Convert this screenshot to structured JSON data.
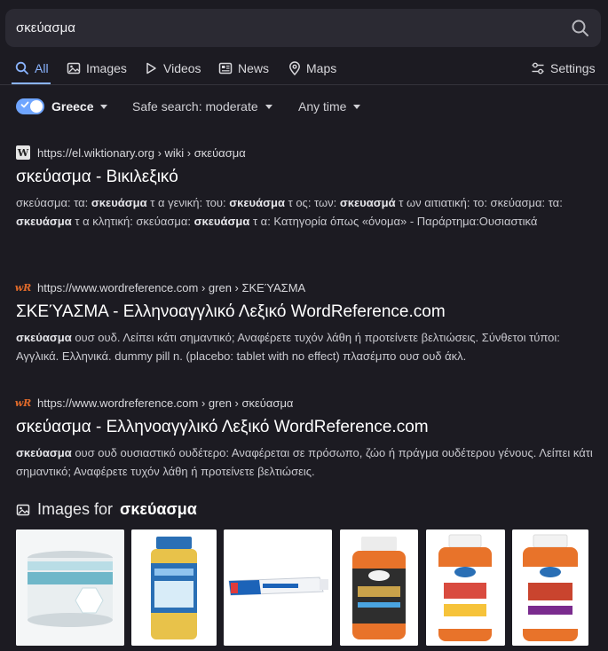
{
  "search": {
    "query": "σκεύασμα"
  },
  "tabs": [
    {
      "label": "All",
      "icon": "search-icon"
    },
    {
      "label": "Images",
      "icon": "image-icon"
    },
    {
      "label": "Videos",
      "icon": "play-icon"
    },
    {
      "label": "News",
      "icon": "news-icon"
    },
    {
      "label": "Maps",
      "icon": "map-pin-icon"
    }
  ],
  "settings_label": "Settings",
  "filters": {
    "region": "Greece",
    "safe_search": "Safe search: moderate",
    "time": "Any time"
  },
  "results": [
    {
      "url": "https://el.wiktionary.org › wiki › σκεύασμα",
      "title": "σκεύασμα - Βικιλεξικό",
      "favicon": "W",
      "snippet_html": "σκεύασμα: τα: <b>σκευάσμα</b> τ α γενική: του: <b>σκευάσμα</b> τ ος: των: <b>σκευασμά</b> τ ων αιτιατική: το: σκεύασμα: τα: <b>σκευάσμα</b> τ α κλητική: σκεύασμα: <b>σκευάσμα</b> τ α: Κατηγορία όπως «όνομα» - Παράρτημα:Ουσιαστικά"
    },
    {
      "url": "https://www.wordreference.com › gren › ΣΚΕΎΑΣΜΑ",
      "title": "ΣΚΕΎΑΣΜΑ - Ελληνοαγγλικό Λεξικό WordReference.com",
      "favicon": "wR",
      "snippet_html": "<b>σκεύασμα</b> ουσ ουδ. Λείπει κάτι σημαντικό; Αναφέρετε τυχόν λάθη ή προτείνετε βελτιώσεις. Σύνθετοι τύποι: Αγγλικά. Ελληνικά. dummy pill n. (placebo: tablet with no effect) πλασέμπο ουσ ουδ άκλ."
    },
    {
      "url": "https://www.wordreference.com › gren › σκεύασμα",
      "title": "σκεύασμα - Ελληνοαγγλικό Λεξικό WordReference.com",
      "favicon": "wR",
      "snippet_html": "<b>σκεύασμα</b> ουσ ουδ ουσιαστικό ουδέτερο: Αναφέρεται σε πρόσωπο, ζώο ή πράγμα ουδέτερου γένους. Λείπει κάτι σημαντικό; Αναφέρετε τυχόν λάθη ή προτείνετε βελτιώσεις."
    }
  ],
  "images_section": {
    "prefix": "Images for",
    "query": "σκεύασμα"
  },
  "image_thumbs": [
    {
      "text": "SUPER SOLUBLE MAXIBUL",
      "brand": "NUTRICIA",
      "accent": "#6fb7c9"
    },
    {
      "text": "Fish Oil",
      "accent": "#2a6fb5"
    },
    {
      "text": "FRUMULEX",
      "accent": "#1c63b8"
    },
    {
      "text": "TRIBULUS",
      "brand": "NOW",
      "accent": "#e8732a"
    },
    {
      "text": "Caprylic Acid",
      "brand": "NOW",
      "accent": "#d94b3f"
    },
    {
      "text": "Choline & Inositol",
      "brand": "NOW",
      "accent": "#c9442e"
    }
  ]
}
